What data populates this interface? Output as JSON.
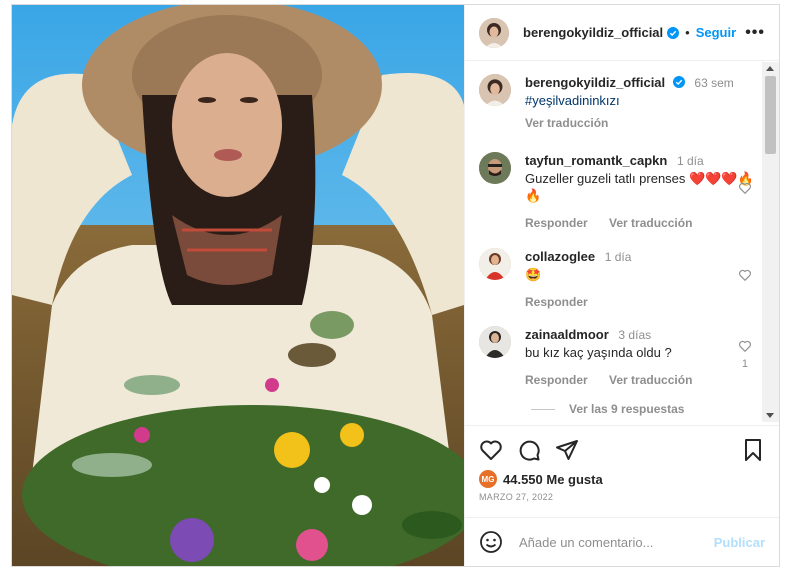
{
  "post": {
    "username": "berengokyildiz_official",
    "follow_label": "Seguir",
    "more_label": "•••",
    "separator": "•"
  },
  "caption": {
    "username": "berengokyildiz_official",
    "time": "63 sem",
    "text": "#yeşilvadininkızı",
    "translate": "Ver traducción"
  },
  "comments": [
    {
      "username": "tayfun_romantk_capkn",
      "time": "1 día",
      "text": "Guzeller guzeli tatlı prenses ❤️❤️❤️🔥🔥",
      "reply": "Responder",
      "translate": "Ver traducción"
    },
    {
      "username": "collazoglee",
      "time": "1 día",
      "text": "🤩",
      "reply": "Responder"
    },
    {
      "username": "zainaaldmoor",
      "time": "3 días",
      "text": "bu kız kaç yaşında oldu ?",
      "reply": "Responder",
      "translate": "Ver traducción",
      "likes": "1"
    }
  ],
  "replies_label": "Ver las 9 respuestas",
  "likes": {
    "count_text": "44.550 Me gusta",
    "badge": "MG"
  },
  "date": "MARZO 27, 2022",
  "add_comment": {
    "placeholder": "Añade un comentario...",
    "publish": "Publicar"
  },
  "colors": {
    "accent": "#0095f6",
    "publish_disabled": "#b2dffc",
    "muted": "#8e8e8e",
    "hashtag": "#00376b"
  },
  "icons": [
    "heart-icon",
    "comment-icon",
    "share-icon",
    "bookmark-icon",
    "emoji-icon",
    "verified-icon",
    "more-icon"
  ]
}
